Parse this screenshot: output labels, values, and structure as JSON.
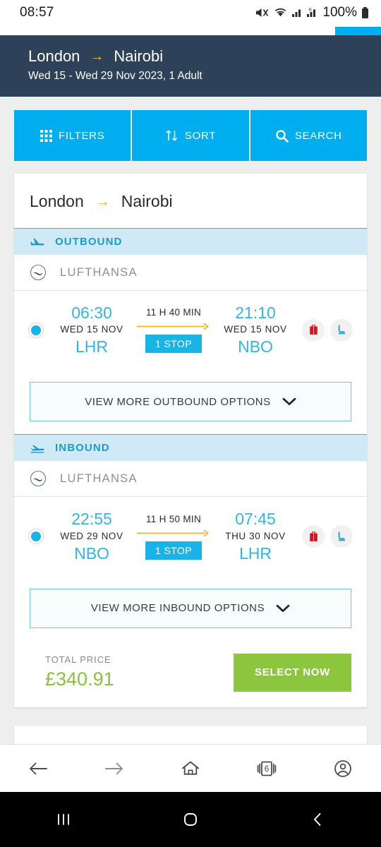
{
  "status_bar": {
    "time": "08:57",
    "battery_percent": "100%",
    "icons": [
      "mute-icon",
      "wifi-icon",
      "signal-icon",
      "signal-roaming-icon",
      "battery-icon"
    ]
  },
  "browser": {
    "progress_percent": 12,
    "bottom_nav": [
      {
        "name": "back-icon",
        "label": "Back"
      },
      {
        "name": "forward-icon",
        "label": "Forward"
      },
      {
        "name": "home-icon",
        "label": "Home"
      },
      {
        "name": "tabs-icon",
        "label": "Tabs",
        "count": "6"
      },
      {
        "name": "account-icon",
        "label": "Account"
      }
    ]
  },
  "android_nav": [
    {
      "name": "recents-icon",
      "label": "Recents"
    },
    {
      "name": "home-circle-icon",
      "label": "Home"
    },
    {
      "name": "back-chevron-icon",
      "label": "Back"
    }
  ],
  "site_header": {
    "origin": "London",
    "arrow": "→",
    "destination": "Nairobi",
    "subtitle": "Wed 15 - Wed 29 Nov 2023, 1 Adult"
  },
  "toolbar": {
    "filters_label": "FILTERS",
    "sort_label": "SORT",
    "search_label": "SEARCH"
  },
  "result_card": {
    "route": {
      "origin": "London",
      "arrow": "→",
      "destination": "Nairobi"
    },
    "outbound": {
      "band_label": "OUTBOUND",
      "airline": "LUFTHANSA",
      "depart_time": "06:30",
      "depart_date": "WED 15 NOV",
      "depart_iata": "LHR",
      "duration": "11 H 40 MIN",
      "stops": "1 STOP",
      "arrive_time": "21:10",
      "arrive_date": "WED 15 NOV",
      "arrive_iata": "NBO",
      "amenities": [
        "baggage-icon",
        "seat-icon"
      ],
      "more_label": "VIEW MORE OUTBOUND OPTIONS"
    },
    "inbound": {
      "band_label": "INBOUND",
      "airline": "LUFTHANSA",
      "depart_time": "22:55",
      "depart_date": "WED 29 NOV",
      "depart_iata": "NBO",
      "duration": "11 H 50 MIN",
      "stops": "1 STOP",
      "arrive_time": "07:45",
      "arrive_date": "THU 30 NOV",
      "arrive_iata": "LHR",
      "amenities": [
        "baggage-icon",
        "seat-icon"
      ],
      "more_label": "VIEW MORE INBOUND OPTIONS"
    },
    "price_label": "TOTAL PRICE",
    "price_value": "£340.91",
    "select_label": "SELECT NOW"
  },
  "colors": {
    "brand_blue": "#00aeef",
    "header_navy": "#2d4159",
    "accent_yellow": "#f5b820",
    "band_blue": "#cfeaf6",
    "price_green": "#86c440",
    "select_green": "#8cc63e"
  }
}
